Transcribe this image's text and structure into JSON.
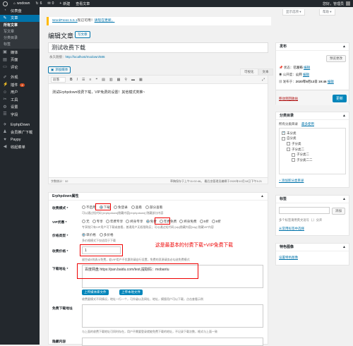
{
  "adminbar": {
    "site": "wodown",
    "updates": "6",
    "comments": "0",
    "new": "新建",
    "view_post": "查看文章",
    "greeting": "您好，管理员"
  },
  "sidebar": {
    "items": [
      {
        "label": "仪表盘",
        "icon": "dashboard-icon"
      },
      {
        "label": "文章",
        "icon": "pin-icon",
        "active": true
      },
      {
        "label": "媒体",
        "icon": "media-icon"
      },
      {
        "label": "页面",
        "icon": "page-icon"
      },
      {
        "label": "评论",
        "icon": "comment-icon"
      },
      {
        "label": "外观",
        "icon": "brush-icon"
      },
      {
        "label": "插件",
        "icon": "plugin-icon",
        "badge": "4"
      },
      {
        "label": "用户",
        "icon": "users-icon"
      },
      {
        "label": "工具",
        "icon": "tools-icon"
      },
      {
        "label": "设置",
        "icon": "settings-icon"
      },
      {
        "label": "字段",
        "icon": "fields-icon"
      },
      {
        "label": "ErphpDown",
        "icon": "erphpdown-icon"
      },
      {
        "label": "会员推广下载",
        "icon": "promo-icon"
      },
      {
        "label": "Paypy",
        "icon": "pay-icon"
      },
      {
        "label": "收起菜单",
        "icon": "collapse-icon"
      }
    ],
    "submenu": [
      "所有文章",
      "写文章",
      "分类目录",
      "标签"
    ]
  },
  "screen_options": "显示选项 ▾",
  "help": "帮助 ▾",
  "notice": {
    "link1": "WordPress 5.5.1",
    "text": "现已可用！",
    "link2": "请现在更新。"
  },
  "page_title": "编辑文章",
  "add_new": "写文章",
  "post_title": "测试收费下载",
  "permalink": {
    "label": "永久链接：",
    "url": "http://localhost/modown/586"
  },
  "add_media": "添加媒体",
  "editor": {
    "tab_visual": "可视化",
    "tab_text": "文本",
    "format": "段落",
    "content": "测试Erphpdown收费下载，VIP免费的设置！其他模式类推~",
    "word_count": "字数统计：32",
    "saved": "最后由管理员编辑于2020年10月18日下午3:21",
    "draft": "草稿保存于上午11:02:46。"
  },
  "erphp": {
    "title": "Erphpdown属性",
    "collect_label": "收费模式 *",
    "collect_options": [
      "不启用",
      "下载",
      "免登录",
      "查看",
      "部分查看"
    ],
    "collect_selected": 1,
    "collect_desc": "可以通过短代码 [erphpdown]隐藏内容[/erphpdown] 隐藏部分内容",
    "vip_label": "VIP优惠 *",
    "vip_options": [
      "无",
      "专享",
      "年费专享",
      "终身专享",
      "免费",
      "年费免费",
      "终身免费",
      "5折",
      "8折"
    ],
    "vip_selected": 4,
    "vip_desc": "专享指只有VIP用户可下载或查看，普通用户无权限购买；可以通过短代码 [vip]隐藏内容[/vip] 隐藏VIP内容",
    "price_type_label": "价格类型 *",
    "price_type_options": [
      "单价格",
      "多价格"
    ],
    "price_type_selected": 0,
    "price_type_desc": "多价格模式下仅适用于下载",
    "price_label": "收费价格 *",
    "price_value": "1",
    "price_desc": "留空或0则表示免费，若VIP用户不优惠则请自行设置，免费的资源请务必勾选免费模式",
    "annotation": "这是最基本的付费下载+VIP免费下载",
    "download_label": "下载地址 *",
    "download_value": "百度网盘 https://pan.baidu.com/test,提取码：mobantu",
    "upload_btn1": "上传媒体库文件",
    "upload_btn2": "上传本地文件",
    "download_desc": "收费要模式不同情况，地址一行一个，可升级以及网址、地址，模版用户可以下载，点击查看示例",
    "free_label": "免费下载地址",
    "free_desc": "与上面的收费下载地址可同时存在，用户不需要登录就能免费下载的地址，不记录下载次数，格式与上面一致",
    "hidden_label": "隐藏内容"
  },
  "publish": {
    "title": "发布",
    "preview": "预览更改",
    "status_label": "状态：",
    "status_value": "已发布",
    "visibility_label": "公开度：",
    "visibility_value": "公开",
    "published_label": "发布于：",
    "published_value": "2020年9月13日 19:46",
    "edit": "编辑",
    "trash": "移动到回收站",
    "update": "更新"
  },
  "categories": {
    "title": "分类目录",
    "tab_all": "所有分类目录",
    "tab_popular": "最多使用",
    "items": [
      {
        "label": "未分类",
        "checked": true,
        "level": 0
      },
      {
        "label": "自分类",
        "checked": false,
        "level": 0
      },
      {
        "label": "子分类",
        "checked": false,
        "level": 1
      },
      {
        "label": "子分类二",
        "checked": false,
        "level": 1
      },
      {
        "label": "子分类二",
        "checked": false,
        "level": 2
      },
      {
        "label": "子分类二二",
        "checked": false,
        "level": 2
      }
    ],
    "add_new": "+ 添加新分类目录"
  },
  "tags": {
    "title": "标签",
    "add_btn": "添加",
    "desc": "多个标签请用英文逗号（,）分开",
    "choose": "从常用标签中选择"
  },
  "featured": {
    "title": "特色图像",
    "set": "设置特色图像"
  }
}
